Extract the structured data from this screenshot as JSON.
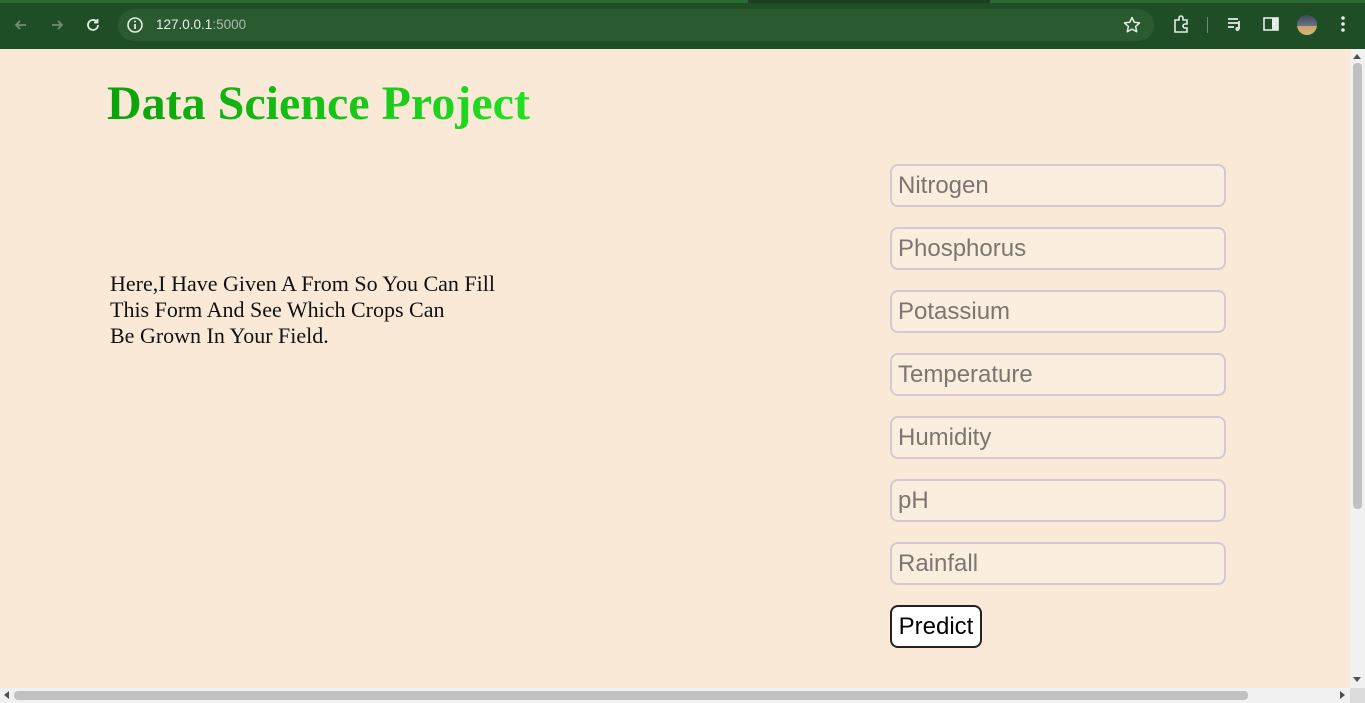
{
  "browser": {
    "url_host": "127.0.0.1",
    "url_port": ":5000",
    "icons": [
      "back-arrow-icon",
      "forward-arrow-icon",
      "reload-icon",
      "site-info-icon",
      "bookmark-star-icon",
      "extensions-icon",
      "media-controls-icon",
      "side-panel-icon",
      "profile-avatar",
      "more-menu-icon"
    ]
  },
  "page": {
    "title": "Data Science Project",
    "intro_lines": [
      "Here,I Have Given A From So You Can Fill",
      "This Form And See Which Crops Can",
      "Be Grown In Your Field."
    ],
    "form": {
      "fields": [
        {
          "placeholder": "Nitrogen",
          "value": ""
        },
        {
          "placeholder": "Phosphorus",
          "value": ""
        },
        {
          "placeholder": "Potassium",
          "value": ""
        },
        {
          "placeholder": "Temperature",
          "value": ""
        },
        {
          "placeholder": "Humidity",
          "value": ""
        },
        {
          "placeholder": "pH",
          "value": ""
        },
        {
          "placeholder": "Rainfall",
          "value": ""
        }
      ],
      "submit_label": "Predict"
    }
  },
  "colors": {
    "chrome_bg": "#1f4d26",
    "page_bg": "#fae9d6",
    "title_gradient_start": "#0aa20a",
    "title_gradient_end": "#23e023"
  }
}
